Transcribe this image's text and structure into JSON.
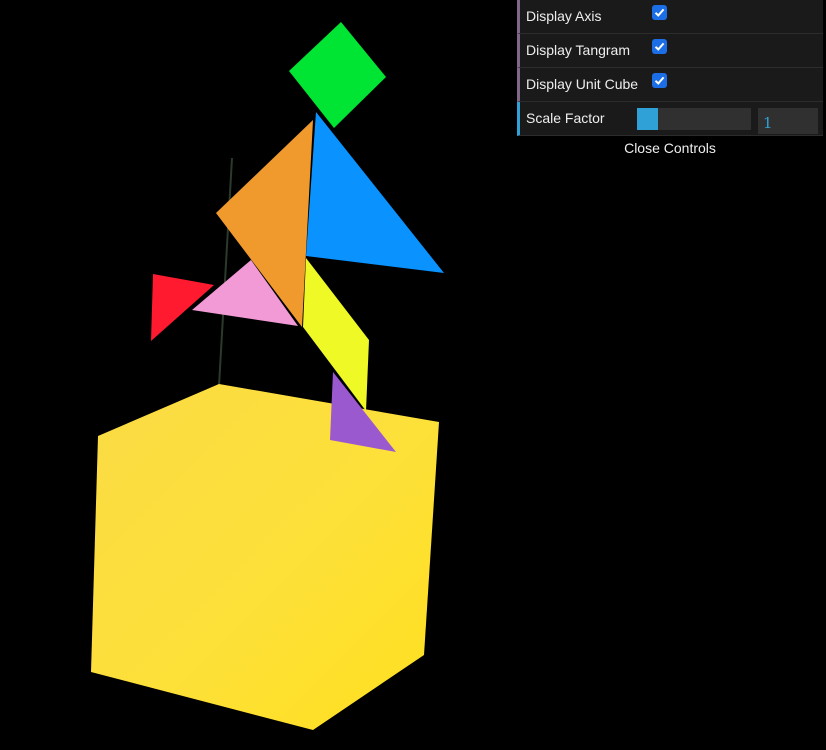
{
  "controls": {
    "display_axis": {
      "label": "Display Axis",
      "checked": true
    },
    "display_tangram": {
      "label": "Display Tangram",
      "checked": true
    },
    "display_unit_cube": {
      "label": "Display Unit Cube",
      "checked": true
    },
    "scale_factor": {
      "label": "Scale Factor",
      "value": "1",
      "slider_fraction": 0.18
    },
    "close_label": "Close Controls"
  },
  "colors": {
    "background": "#000000",
    "cube": "#ffde2c",
    "tangram_green": "#00e533",
    "tangram_orange": "#f09a2e",
    "tangram_blue": "#0a93ff",
    "tangram_red": "#ff1a30",
    "tangram_pink": "#f19ad6",
    "tangram_yellow": "#eef925",
    "tangram_purple": "#9b59d0",
    "gui_checkbox": "#1c6ee6",
    "gui_number_accent": "#2fa1d6"
  }
}
